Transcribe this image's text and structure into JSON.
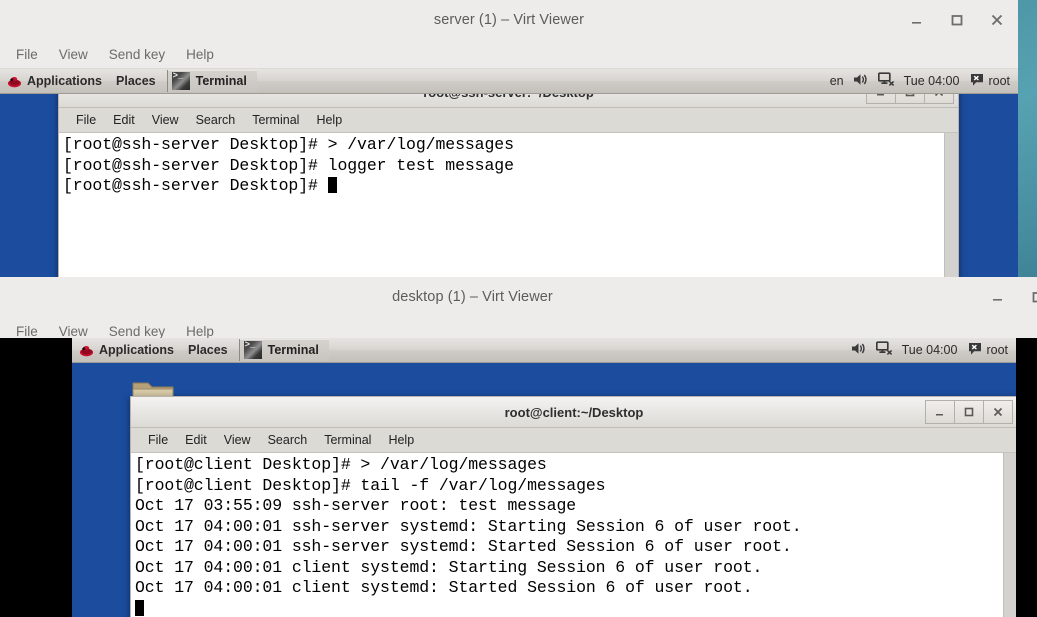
{
  "viewers": [
    {
      "id": "server",
      "title": "server (1) – Virt Viewer",
      "menu": [
        "File",
        "View",
        "Send key",
        "Help"
      ],
      "window_buttons": [
        "minimize",
        "maximize",
        "close"
      ],
      "panel": {
        "applications_label": "Applications",
        "places_label": "Places",
        "task_label": "Terminal",
        "keyboard_layout": "en",
        "clock": "Tue 04:00",
        "user": "root"
      },
      "terminal": {
        "title": "root@ssh-server:~/Desktop",
        "menu": [
          "File",
          "Edit",
          "View",
          "Search",
          "Terminal",
          "Help"
        ],
        "lines": [
          "[root@ssh-server Desktop]# > /var/log/messages",
          "[root@ssh-server Desktop]# logger test message",
          "[root@ssh-server Desktop]# "
        ],
        "cursor_on_last_line": true
      }
    },
    {
      "id": "desktop",
      "title": "desktop (1) – Virt Viewer",
      "menu": [
        "File",
        "View",
        "Send key",
        "Help"
      ],
      "window_buttons": [
        "minimize",
        "maximize"
      ],
      "panel": {
        "applications_label": "Applications",
        "places_label": "Places",
        "task_label": "Terminal",
        "keyboard_layout": "",
        "clock": "Tue 04:00",
        "user": "root"
      },
      "terminal": {
        "title": "root@client:~/Desktop",
        "menu": [
          "File",
          "Edit",
          "View",
          "Search",
          "Terminal",
          "Help"
        ],
        "lines": [
          "[root@client Desktop]# > /var/log/messages",
          "[root@client Desktop]# tail -f /var/log/messages",
          "Oct 17 03:55:09 ssh-server root: test message",
          "Oct 17 04:00:01 ssh-server systemd: Starting Session 6 of user root.",
          "Oct 17 04:00:01 ssh-server systemd: Started Session 6 of user root.",
          "Oct 17 04:00:01 client systemd: Starting Session 6 of user root.",
          "Oct 17 04:00:01 client systemd: Started Session 6 of user root.",
          ""
        ],
        "cursor_on_last_line": true
      }
    }
  ],
  "colors": {
    "chrome_bg": "#edecea",
    "guest_desktop_blue": "#1b4c9e",
    "host_desktop_teal": "#4e97a8",
    "terminal_fg": "#000000",
    "terminal_bg": "#ffffff"
  }
}
